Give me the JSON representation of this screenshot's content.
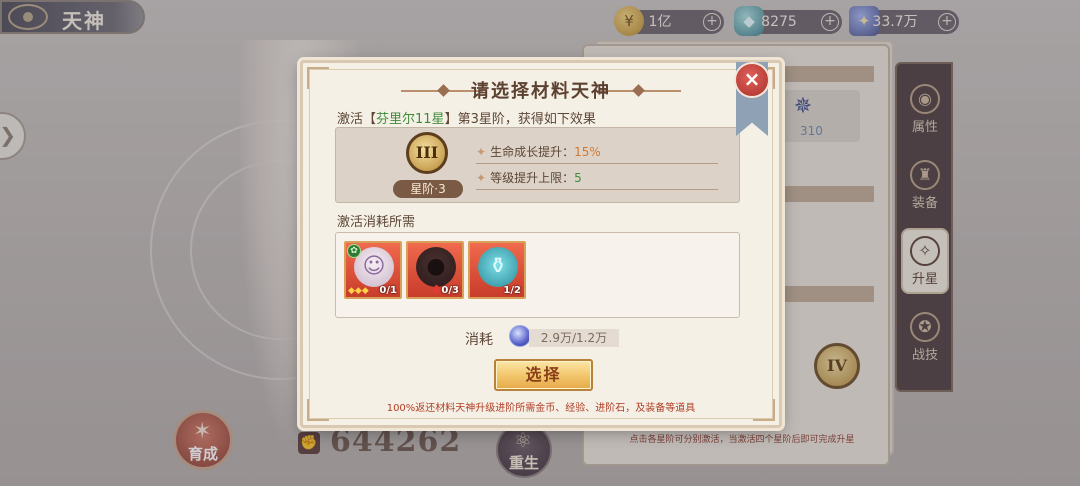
{
  "header": {
    "title": "天神",
    "currencies": [
      {
        "name": "gold",
        "value": "1亿"
      },
      {
        "name": "gem",
        "value": "8275"
      },
      {
        "name": "item",
        "value": "33.7万"
      }
    ]
  },
  "side_tabs": [
    {
      "label": "属性"
    },
    {
      "label": "装备"
    },
    {
      "label": "升星"
    },
    {
      "label": "战技"
    }
  ],
  "book": {
    "stat_value": "310",
    "rank_numeral": "IV",
    "hint": "点击各星阶可分别激活，当激活四个星阶后即可完成升星"
  },
  "bottom": {
    "nurture_label": "育成",
    "power_value": "644262",
    "rebirth_label": "重生"
  },
  "modal": {
    "title": "请选择材料天神",
    "close_symbol": "×",
    "activate_prefix": "激活【",
    "activate_target": "芬里尔11星",
    "activate_suffix": "】第3星阶，获得如下效果",
    "rank": {
      "numeral": "III",
      "label": "星阶·3"
    },
    "effects": [
      {
        "label": "生命成长提升：",
        "value": "15%"
      },
      {
        "label": "等级提升上限：",
        "value": "5"
      }
    ],
    "cost_heading": "激活消耗所需",
    "materials": [
      {
        "kind": "character",
        "count": "0/1"
      },
      {
        "kind": "silhouette",
        "count": "0/3"
      },
      {
        "kind": "potion",
        "count": "1/2"
      }
    ],
    "consume_label": "消耗",
    "consume_value": "2.9万/1.2万",
    "select_label": "选择",
    "refund_note": "100%返还材料天神升级进阶所需金币、经验、进阶石，及装备等道具"
  },
  "colors": {
    "accent_green": "#3f8b3a",
    "accent_orange": "#d17a32",
    "close_red": "#c4433b",
    "button_gold": "#f1c469"
  }
}
